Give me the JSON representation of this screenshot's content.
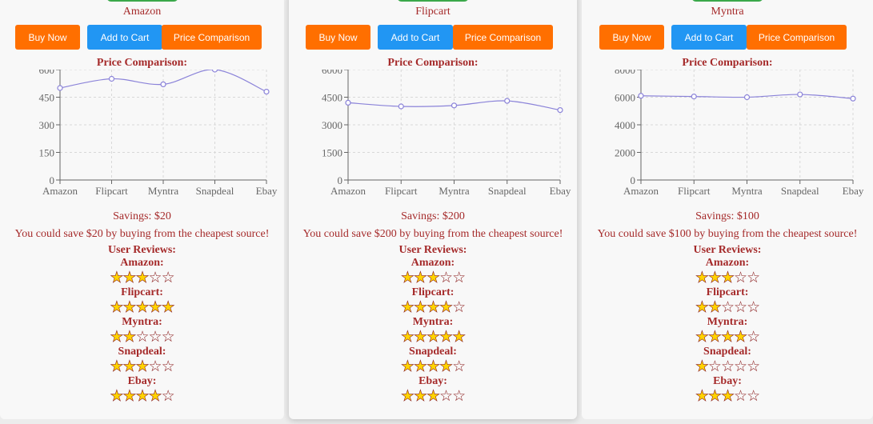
{
  "labels": {
    "buy_now": "Buy Now",
    "add_to_cart": "Add to Cart",
    "price_comparison": "Price Comparison",
    "price_comparison_title": "Price Comparison:",
    "user_reviews": "User Reviews:"
  },
  "colors": {
    "orange": "#ff6f00",
    "blue": "#2196f3",
    "text": "#a52a2a",
    "star": "#ffd400",
    "line": "#8b83d9",
    "green_tab": "#3aa84a"
  },
  "cards": [
    {
      "store": "Amazon",
      "savings": "Savings: $20",
      "message": "You could save $20 by buying from the cheapest source!",
      "reviews": [
        {
          "source": "Amazon:",
          "rating": 3
        },
        {
          "source": "Flipcart:",
          "rating": 5
        },
        {
          "source": "Myntra:",
          "rating": 2
        },
        {
          "source": "Snapdeal:",
          "rating": 3
        },
        {
          "source": "Ebay:",
          "rating": 4
        }
      ]
    },
    {
      "store": "Flipcart",
      "savings": "Savings: $200",
      "message": "You could save $200 by buying from the cheapest source!",
      "reviews": [
        {
          "source": "Amazon:",
          "rating": 3
        },
        {
          "source": "Flipcart:",
          "rating": 4
        },
        {
          "source": "Myntra:",
          "rating": 5
        },
        {
          "source": "Snapdeal:",
          "rating": 4
        },
        {
          "source": "Ebay:",
          "rating": 3
        }
      ]
    },
    {
      "store": "Myntra",
      "savings": "Savings: $100",
      "message": "You could save $100 by buying from the cheapest source!",
      "reviews": [
        {
          "source": "Amazon:",
          "rating": 3
        },
        {
          "source": "Flipcart:",
          "rating": 2
        },
        {
          "source": "Myntra:",
          "rating": 4
        },
        {
          "source": "Snapdeal:",
          "rating": 1
        },
        {
          "source": "Ebay:",
          "rating": 3
        }
      ]
    }
  ],
  "chart_data": [
    {
      "type": "line",
      "categories": [
        "Amazon",
        "Flipcart",
        "Myntra",
        "Snapdeal",
        "Ebay"
      ],
      "values": [
        500,
        550,
        520,
        600,
        480
      ],
      "yticks": [
        "0",
        "150",
        "300",
        "450",
        "600"
      ],
      "ylim": [
        0,
        600
      ],
      "grid": true
    },
    {
      "type": "line",
      "categories": [
        "Amazon",
        "Flipcart",
        "Myntra",
        "Snapdeal",
        "Ebay"
      ],
      "values": [
        4200,
        4000,
        4050,
        4300,
        3800
      ],
      "yticks": [
        "0",
        "1500",
        "3000",
        "4500",
        "6000"
      ],
      "ylim": [
        0,
        6000
      ],
      "grid": true
    },
    {
      "type": "line",
      "categories": [
        "Amazon",
        "Flipcart",
        "Myntra",
        "Snapdeal",
        "Ebay"
      ],
      "values": [
        6100,
        6050,
        6000,
        6200,
        5900
      ],
      "yticks": [
        "0",
        "2000",
        "4000",
        "6000",
        "8000"
      ],
      "ylim": [
        0,
        8000
      ],
      "grid": true
    }
  ]
}
